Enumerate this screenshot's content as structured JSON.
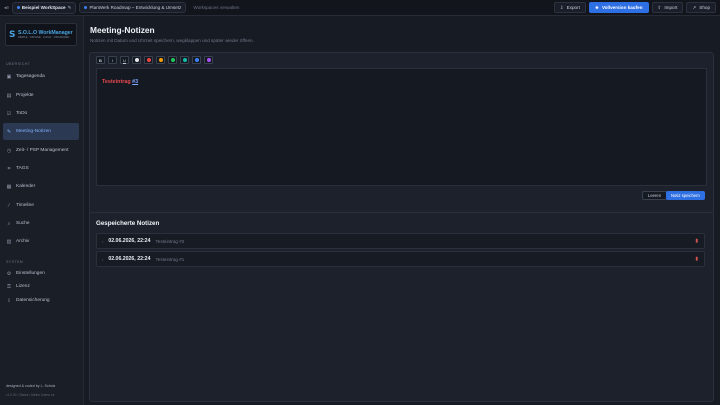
{
  "topbar": {
    "collapse_glyph": "◂≡",
    "workspace": "Beispiel WorkSpace",
    "project": "PlanWerk Roadmap – Entwicklung & Umsetz",
    "manage": "Workspaces verwalten",
    "export": "Export",
    "full_version": "Vollversion kaufen",
    "import": "Import",
    "shop": "Shop"
  },
  "sidebar": {
    "logo_mark": "S",
    "logo_name": "S.O.L.O WorkManager",
    "logo_sub": "SIMPLE · OFFLINE · LOCAL · ORGANIZED",
    "section_overview": "ÜBERSICHT",
    "items": [
      {
        "label": "Tagesagenda",
        "icon": "▣"
      },
      {
        "label": "Projekte",
        "icon": "▤"
      },
      {
        "label": "ToDo",
        "icon": "☑"
      },
      {
        "label": "Meeting-Notizen",
        "icon": "✎"
      },
      {
        "label": "Zeit- / PSP Management",
        "icon": "◷"
      },
      {
        "label": "TAGS",
        "icon": "⌗"
      },
      {
        "label": "Kalender",
        "icon": "▦"
      },
      {
        "label": "Timeline",
        "icon": "⁄"
      },
      {
        "label": "Suche",
        "icon": "⌕"
      },
      {
        "label": "Archiv",
        "icon": "▥"
      }
    ],
    "section_system": "SYSTEM",
    "system_items": [
      {
        "label": "Einstellungen",
        "icon": "⚙"
      },
      {
        "label": "Lizenz",
        "icon": "⚿"
      },
      {
        "label": "Datensicherung",
        "icon": "⇩"
      }
    ],
    "credit": "designed & coded by L. Scholz",
    "version": "v1.0.00  •  Status  •  Meine Lizenz ok"
  },
  "main": {
    "title": "Meeting-Notizen",
    "subtitle": "Notizen mit Datum und Uhrzeit speichern, wegklappen und später wieder öffnen.",
    "format_buttons": [
      "B",
      "I",
      "U"
    ],
    "colors": [
      "#e5e7eb",
      "#ef4444",
      "#f59e0b",
      "#22c55e",
      "#14b8a6",
      "#3b82f6",
      "#a855f7"
    ],
    "editor_text": "Testeintrag ",
    "editor_link": "#3",
    "clear_button": "Leeren",
    "save_button": "Notiz speichern",
    "saved_title": "Gespeicherte Notizen",
    "notes": [
      {
        "date": "02.06.2026, 22:24",
        "preview": "Testeintrag #2"
      },
      {
        "date": "02.06.2026, 22:24",
        "preview": "Testeintrag #1"
      }
    ]
  }
}
